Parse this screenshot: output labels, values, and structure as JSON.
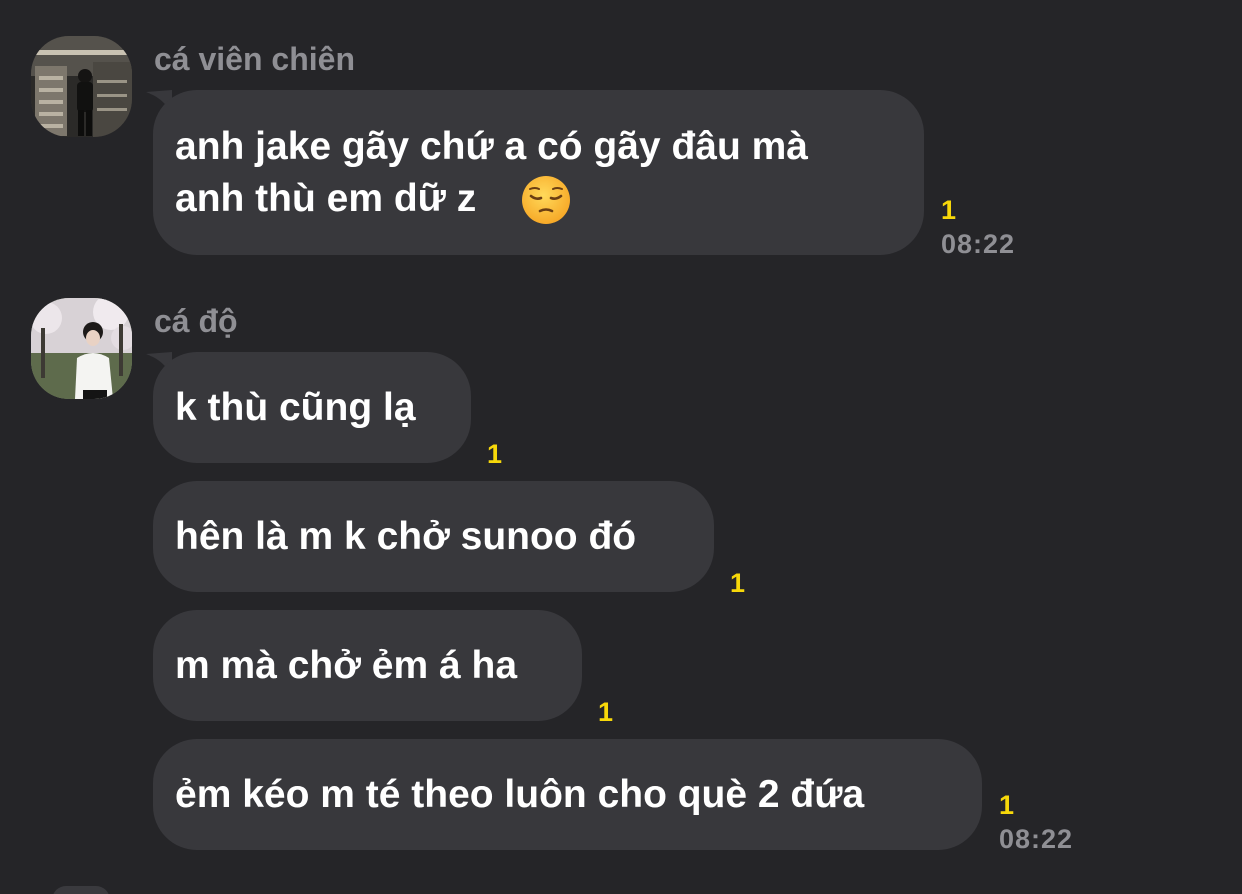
{
  "colors": {
    "background": "#252528",
    "bubble": "#38383c",
    "sender": "#8f8f94",
    "unread": "#f7d80a",
    "time": "#8f8f94"
  },
  "groups": [
    {
      "sender": "cá viên chiên",
      "avatar": "avatar-photo-man-in-stairwell",
      "messages": [
        {
          "text": "anh jake gãy chứ a có gãy đâu mà\nanh thù em dữ z",
          "emoji": "pensive-face-icon",
          "unread": "1",
          "time": "08:22"
        }
      ]
    },
    {
      "sender": "cá độ",
      "avatar": "avatar-photo-boy-cherry-blossoms",
      "messages": [
        {
          "text": "k thù cũng lạ",
          "unread": "1"
        },
        {
          "text": "hên là m k chở sunoo đó",
          "unread": "1"
        },
        {
          "text": "m mà chở ẻm á ha",
          "unread": "1"
        },
        {
          "text": "ẻm kéo m té theo luôn cho què 2 đứa",
          "unread": "1",
          "time": "08:22"
        }
      ]
    }
  ]
}
